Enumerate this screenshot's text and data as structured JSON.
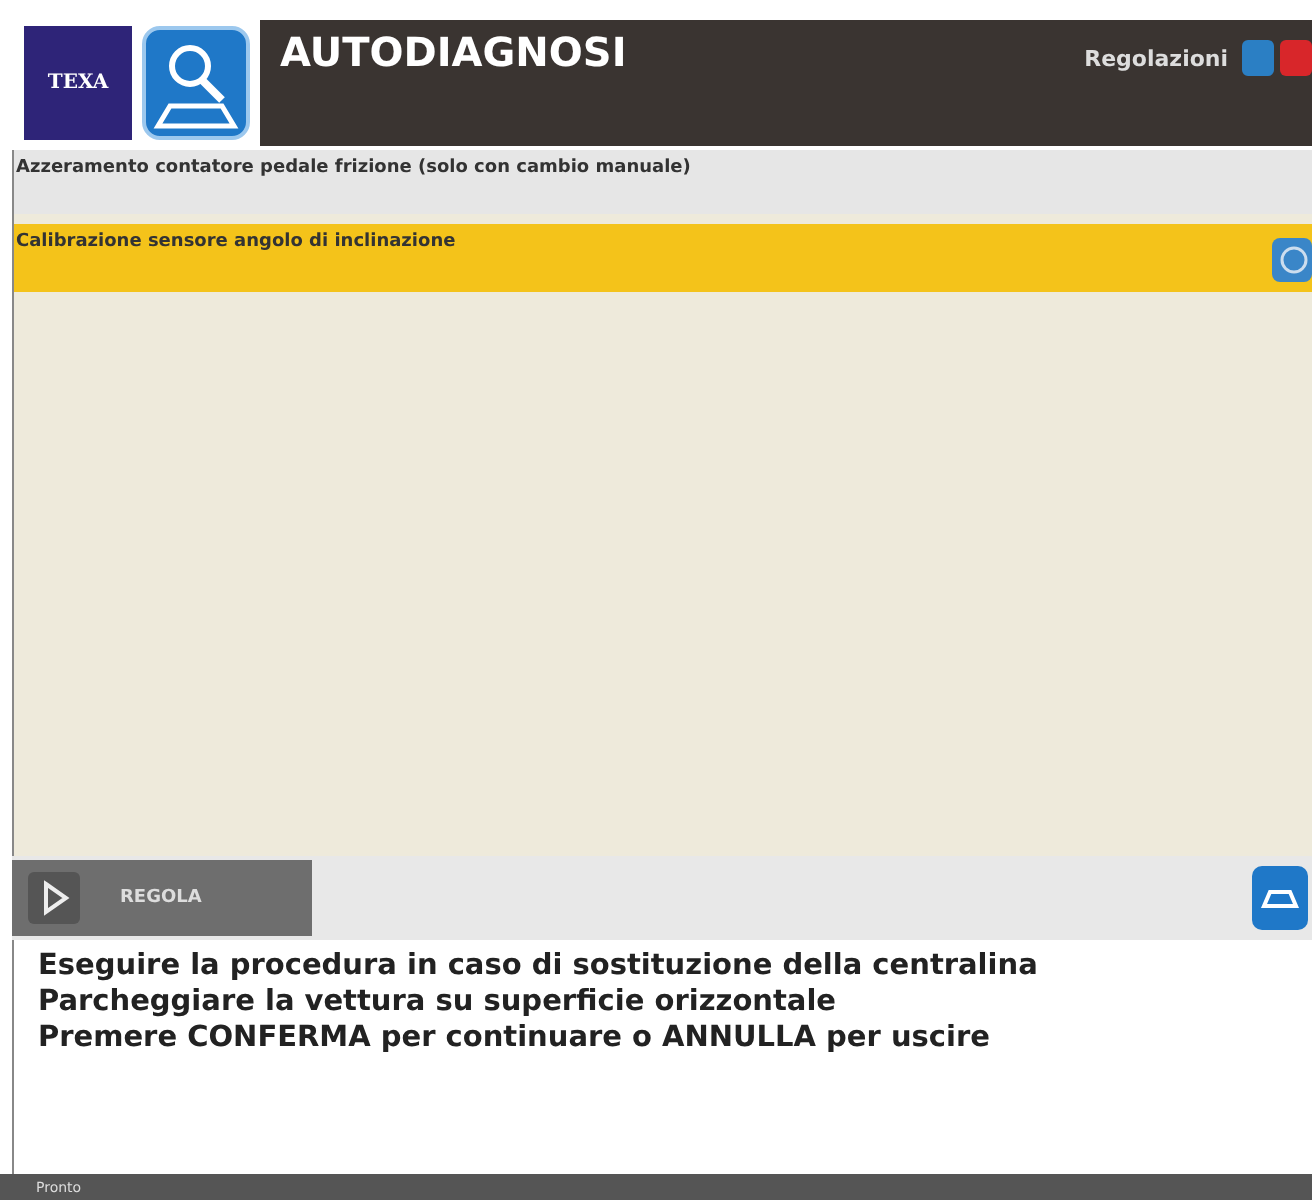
{
  "header": {
    "brand": "TEXA",
    "title": "AUTODIAGNOSI",
    "section": "Regolazioni"
  },
  "items": [
    {
      "label": "Azzeramento contatore pedale frizione (solo con cambio manuale)",
      "selected": false
    },
    {
      "label": "Calibrazione sensore angolo di inclinazione",
      "selected": true
    }
  ],
  "toolbar": {
    "action": "REGOLA"
  },
  "messages": [
    "Eseguire la procedura in caso di sostituzione della centralina",
    "Parcheggiare la vettura su superficie orizzontale",
    "Premere CONFERMA per continuare o ANNULLA per uscire"
  ],
  "status_bar": "Pronto"
}
